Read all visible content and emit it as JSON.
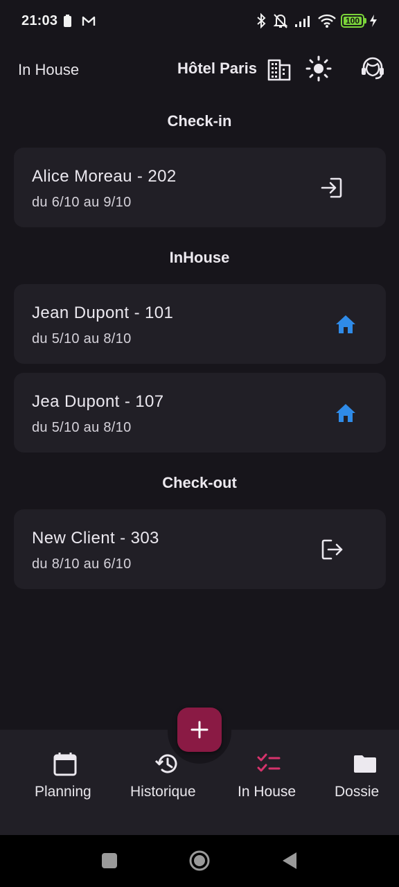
{
  "status_bar": {
    "time": "21:03",
    "battery_level": "100",
    "icons": [
      "battery-saver-icon",
      "gmail-icon",
      "bluetooth-icon",
      "bell-off-icon",
      "signal-icon",
      "wifi-icon",
      "battery-icon",
      "charging-icon"
    ]
  },
  "app_bar": {
    "title": "In House",
    "hotel_name": "Hôtel Paris",
    "icons": [
      "building-icon",
      "sun-icon",
      "support-icon"
    ]
  },
  "sections": {
    "checkin_title": "Check-in",
    "inhouse_title": "InHouse",
    "checkout_title": "Check-out"
  },
  "cards": {
    "checkin": [
      {
        "name": "Alice Moreau - 202",
        "dates": "du 6/10 au 9/10",
        "icon": "login-icon"
      }
    ],
    "inhouse": [
      {
        "name": "Jean Dupont - 101",
        "dates": "du 5/10 au 8/10",
        "icon": "home-icon"
      },
      {
        "name": "Jea Dupont - 107",
        "dates": "du 5/10 au 8/10",
        "icon": "home-icon"
      }
    ],
    "checkout": [
      {
        "name": "New Client - 303",
        "dates": "du 8/10 au 6/10",
        "icon": "logout-icon"
      }
    ]
  },
  "colors": {
    "background": "#17151b",
    "card": "#211f26",
    "accent": "#8a1a44",
    "active_nav": "#d6336c",
    "home_icon": "#2f8be8"
  },
  "fab": {
    "icon": "plus-icon"
  },
  "bottom_nav": {
    "items": [
      {
        "label": "Planning",
        "icon": "calendar-icon"
      },
      {
        "label": "Historique",
        "icon": "history-icon"
      },
      {
        "label": "In House",
        "icon": "checklist-icon",
        "active": true
      },
      {
        "label": "Dossie",
        "icon": "folder-icon"
      }
    ]
  },
  "system_nav": {
    "icons": [
      "recents-icon",
      "home-circle-icon",
      "back-icon"
    ]
  }
}
